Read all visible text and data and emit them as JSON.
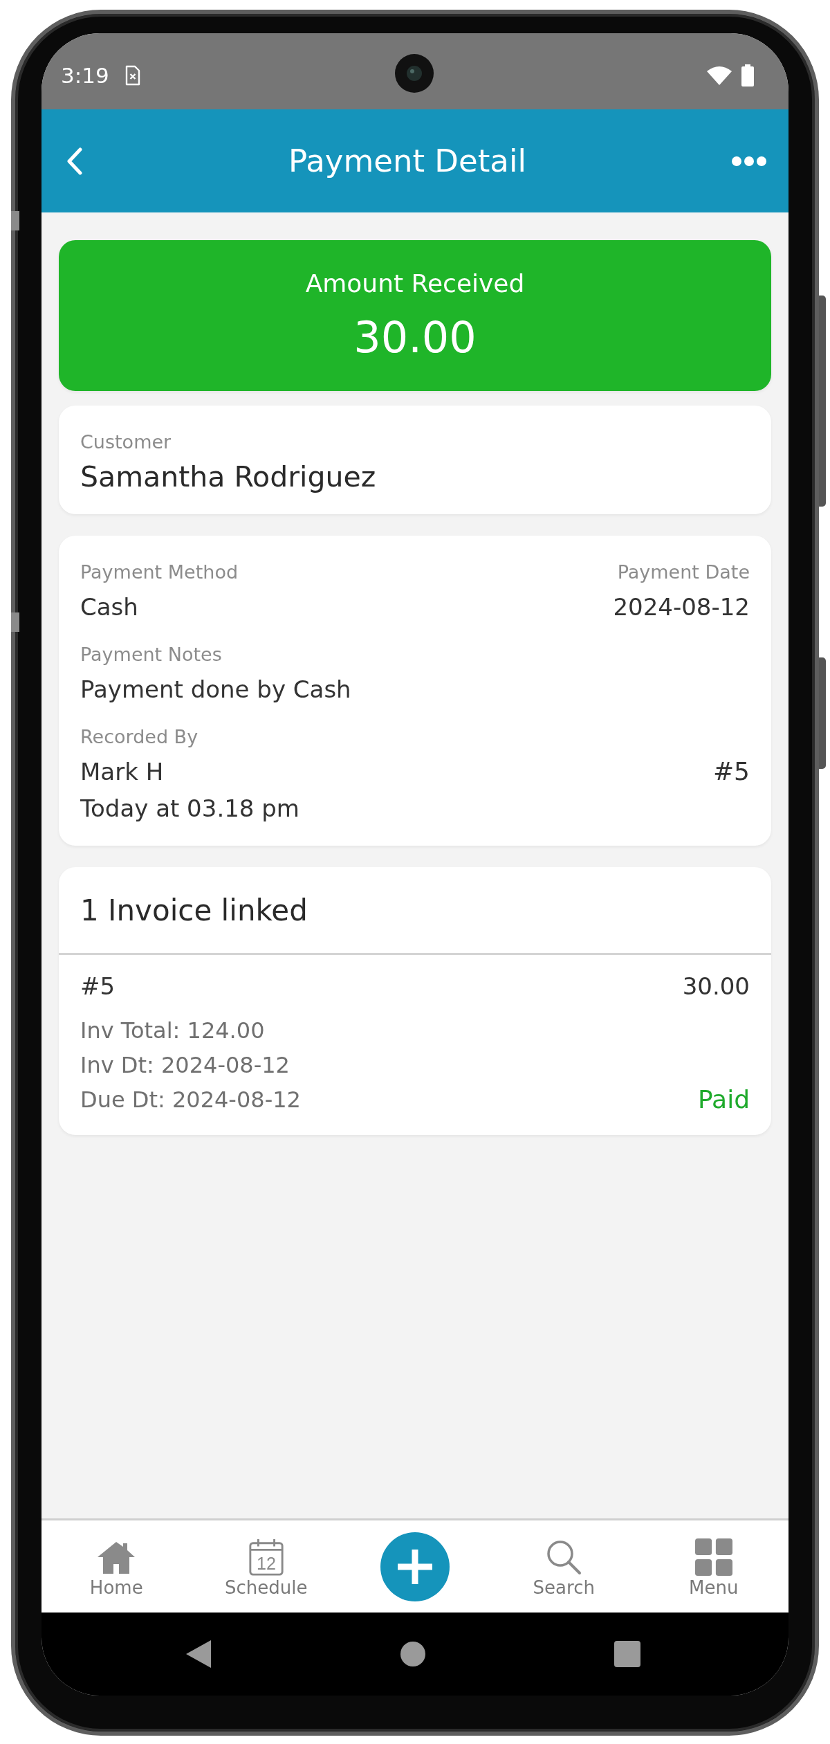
{
  "status_bar": {
    "time": "3:19"
  },
  "app_bar": {
    "title": "Payment Detail"
  },
  "amount_card": {
    "label": "Amount Received",
    "amount": "30.00"
  },
  "customer": {
    "label": "Customer",
    "name": "Samantha Rodriguez"
  },
  "details": {
    "payment_method_label": "Payment Method",
    "payment_method": "Cash",
    "payment_date_label": "Payment Date",
    "payment_date": "2024-08-12",
    "notes_label": "Payment Notes",
    "notes": "Payment done by Cash",
    "recorded_by_label": "Recorded By",
    "recorded_by": "Mark H",
    "recorded_at": "Today at 03.18 pm",
    "payment_number": "#5"
  },
  "invoices": {
    "header": "1 Invoice linked",
    "items": [
      {
        "number": "#5",
        "amount": "30.00",
        "total": "Inv Total: 124.00",
        "inv_date": "Inv Dt: 2024-08-12",
        "due_date": "Due Dt: 2024-08-12",
        "status": "Paid",
        "color": "#1faa2c"
      }
    ]
  },
  "bottom_nav": [
    {
      "kind": "home",
      "label": "Home"
    },
    {
      "kind": "schedule",
      "label": "Schedule",
      "icon_text": "12"
    },
    {
      "kind": "add"
    },
    {
      "kind": "search",
      "label": "Search"
    },
    {
      "kind": "menu",
      "label": "Menu"
    }
  ]
}
